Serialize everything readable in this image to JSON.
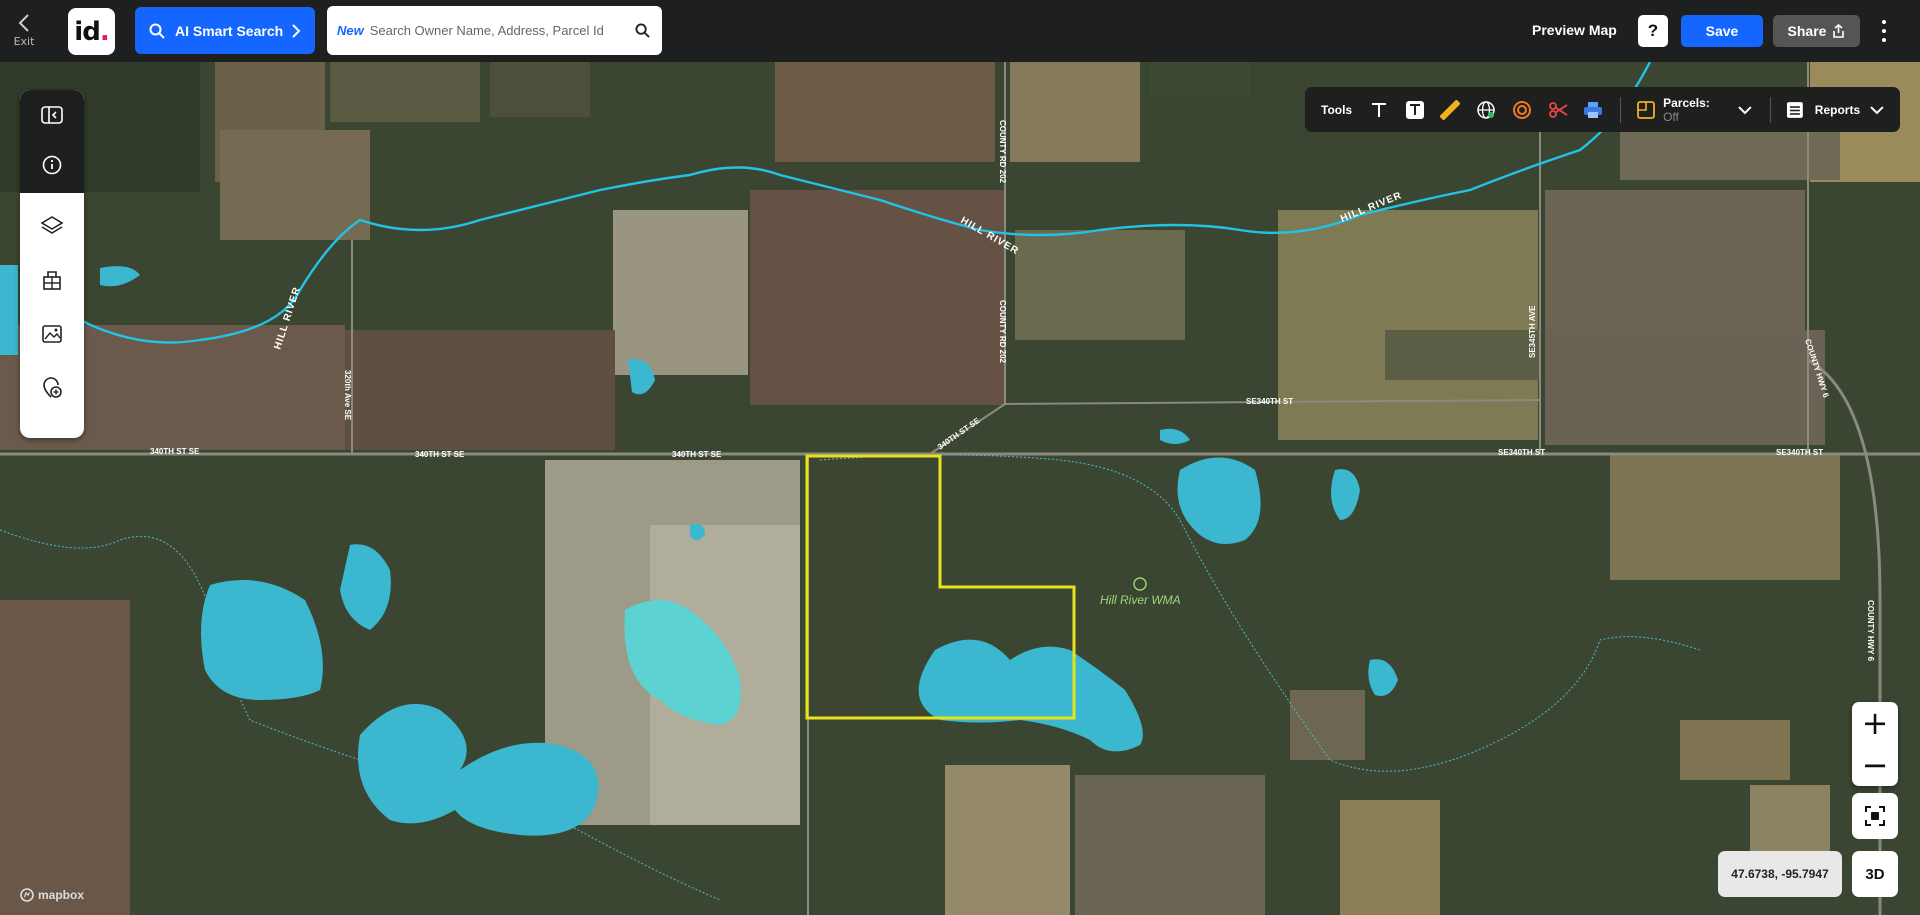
{
  "topbar": {
    "exit_label": "Exit",
    "logo_text": "id",
    "ai_search_label": "AI Smart Search",
    "search_new_badge": "New",
    "search_placeholder": "Search Owner Name, Address, Parcel Id",
    "preview_map_label": "Preview Map",
    "help_label": "?",
    "save_label": "Save",
    "share_label": "Share"
  },
  "tools": {
    "label": "Tools",
    "parcels_label": "Parcels:",
    "parcels_state": "Off",
    "reports_label": "Reports"
  },
  "map": {
    "labels": {
      "hill_river_1": "HILL RIVER",
      "hill_river_2": "HILL RIVER",
      "hill_river_3": "HILL RIVER",
      "county_rd_202_a": "COUNTY RD 202",
      "county_rd_202_b": "COUNTY RD 202",
      "ave_320th": "320th Ave SE",
      "st_340th_1": "340TH ST SE",
      "st_340th_2": "340TH ST SE",
      "st_340th_3": "340TH ST SE",
      "st_340th_4": "340TH ST SE",
      "se340th_1": "SE340TH ST",
      "se340th_2": "SE340TH ST",
      "se340th_3": "SE340TH ST",
      "se345th": "SE345TH AVE",
      "county_hwy_6_a": "COUNTY HWY 6",
      "county_hwy_6_b": "COUNTY HWY 6",
      "wma": "Hill River WMA"
    },
    "coordinates": "47.6738, -95.7947",
    "three_d_label": "3D",
    "zoom_in": "+",
    "zoom_out": "−",
    "attribution": "mapbox"
  },
  "colors": {
    "accent": "#1565ff",
    "water": "#3bb7cf",
    "parcel_outline": "#e8e21a",
    "river": "#22c3e6"
  }
}
